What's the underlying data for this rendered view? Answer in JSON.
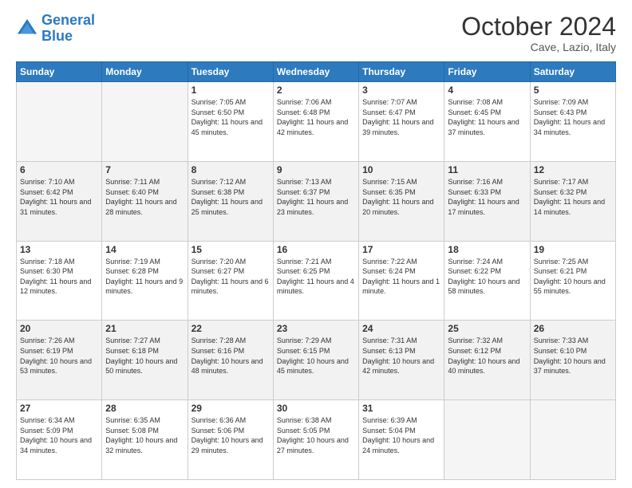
{
  "header": {
    "logo_line1": "General",
    "logo_line2": "Blue",
    "month": "October 2024",
    "location": "Cave, Lazio, Italy"
  },
  "days_of_week": [
    "Sunday",
    "Monday",
    "Tuesday",
    "Wednesday",
    "Thursday",
    "Friday",
    "Saturday"
  ],
  "weeks": [
    [
      {
        "day": "",
        "info": ""
      },
      {
        "day": "",
        "info": ""
      },
      {
        "day": "1",
        "info": "Sunrise: 7:05 AM\nSunset: 6:50 PM\nDaylight: 11 hours and 45 minutes."
      },
      {
        "day": "2",
        "info": "Sunrise: 7:06 AM\nSunset: 6:48 PM\nDaylight: 11 hours and 42 minutes."
      },
      {
        "day": "3",
        "info": "Sunrise: 7:07 AM\nSunset: 6:47 PM\nDaylight: 11 hours and 39 minutes."
      },
      {
        "day": "4",
        "info": "Sunrise: 7:08 AM\nSunset: 6:45 PM\nDaylight: 11 hours and 37 minutes."
      },
      {
        "day": "5",
        "info": "Sunrise: 7:09 AM\nSunset: 6:43 PM\nDaylight: 11 hours and 34 minutes."
      }
    ],
    [
      {
        "day": "6",
        "info": "Sunrise: 7:10 AM\nSunset: 6:42 PM\nDaylight: 11 hours and 31 minutes."
      },
      {
        "day": "7",
        "info": "Sunrise: 7:11 AM\nSunset: 6:40 PM\nDaylight: 11 hours and 28 minutes."
      },
      {
        "day": "8",
        "info": "Sunrise: 7:12 AM\nSunset: 6:38 PM\nDaylight: 11 hours and 25 minutes."
      },
      {
        "day": "9",
        "info": "Sunrise: 7:13 AM\nSunset: 6:37 PM\nDaylight: 11 hours and 23 minutes."
      },
      {
        "day": "10",
        "info": "Sunrise: 7:15 AM\nSunset: 6:35 PM\nDaylight: 11 hours and 20 minutes."
      },
      {
        "day": "11",
        "info": "Sunrise: 7:16 AM\nSunset: 6:33 PM\nDaylight: 11 hours and 17 minutes."
      },
      {
        "day": "12",
        "info": "Sunrise: 7:17 AM\nSunset: 6:32 PM\nDaylight: 11 hours and 14 minutes."
      }
    ],
    [
      {
        "day": "13",
        "info": "Sunrise: 7:18 AM\nSunset: 6:30 PM\nDaylight: 11 hours and 12 minutes."
      },
      {
        "day": "14",
        "info": "Sunrise: 7:19 AM\nSunset: 6:28 PM\nDaylight: 11 hours and 9 minutes."
      },
      {
        "day": "15",
        "info": "Sunrise: 7:20 AM\nSunset: 6:27 PM\nDaylight: 11 hours and 6 minutes."
      },
      {
        "day": "16",
        "info": "Sunrise: 7:21 AM\nSunset: 6:25 PM\nDaylight: 11 hours and 4 minutes."
      },
      {
        "day": "17",
        "info": "Sunrise: 7:22 AM\nSunset: 6:24 PM\nDaylight: 11 hours and 1 minute."
      },
      {
        "day": "18",
        "info": "Sunrise: 7:24 AM\nSunset: 6:22 PM\nDaylight: 10 hours and 58 minutes."
      },
      {
        "day": "19",
        "info": "Sunrise: 7:25 AM\nSunset: 6:21 PM\nDaylight: 10 hours and 55 minutes."
      }
    ],
    [
      {
        "day": "20",
        "info": "Sunrise: 7:26 AM\nSunset: 6:19 PM\nDaylight: 10 hours and 53 minutes."
      },
      {
        "day": "21",
        "info": "Sunrise: 7:27 AM\nSunset: 6:18 PM\nDaylight: 10 hours and 50 minutes."
      },
      {
        "day": "22",
        "info": "Sunrise: 7:28 AM\nSunset: 6:16 PM\nDaylight: 10 hours and 48 minutes."
      },
      {
        "day": "23",
        "info": "Sunrise: 7:29 AM\nSunset: 6:15 PM\nDaylight: 10 hours and 45 minutes."
      },
      {
        "day": "24",
        "info": "Sunrise: 7:31 AM\nSunset: 6:13 PM\nDaylight: 10 hours and 42 minutes."
      },
      {
        "day": "25",
        "info": "Sunrise: 7:32 AM\nSunset: 6:12 PM\nDaylight: 10 hours and 40 minutes."
      },
      {
        "day": "26",
        "info": "Sunrise: 7:33 AM\nSunset: 6:10 PM\nDaylight: 10 hours and 37 minutes."
      }
    ],
    [
      {
        "day": "27",
        "info": "Sunrise: 6:34 AM\nSunset: 5:09 PM\nDaylight: 10 hours and 34 minutes."
      },
      {
        "day": "28",
        "info": "Sunrise: 6:35 AM\nSunset: 5:08 PM\nDaylight: 10 hours and 32 minutes."
      },
      {
        "day": "29",
        "info": "Sunrise: 6:36 AM\nSunset: 5:06 PM\nDaylight: 10 hours and 29 minutes."
      },
      {
        "day": "30",
        "info": "Sunrise: 6:38 AM\nSunset: 5:05 PM\nDaylight: 10 hours and 27 minutes."
      },
      {
        "day": "31",
        "info": "Sunrise: 6:39 AM\nSunset: 5:04 PM\nDaylight: 10 hours and 24 minutes."
      },
      {
        "day": "",
        "info": ""
      },
      {
        "day": "",
        "info": ""
      }
    ]
  ]
}
